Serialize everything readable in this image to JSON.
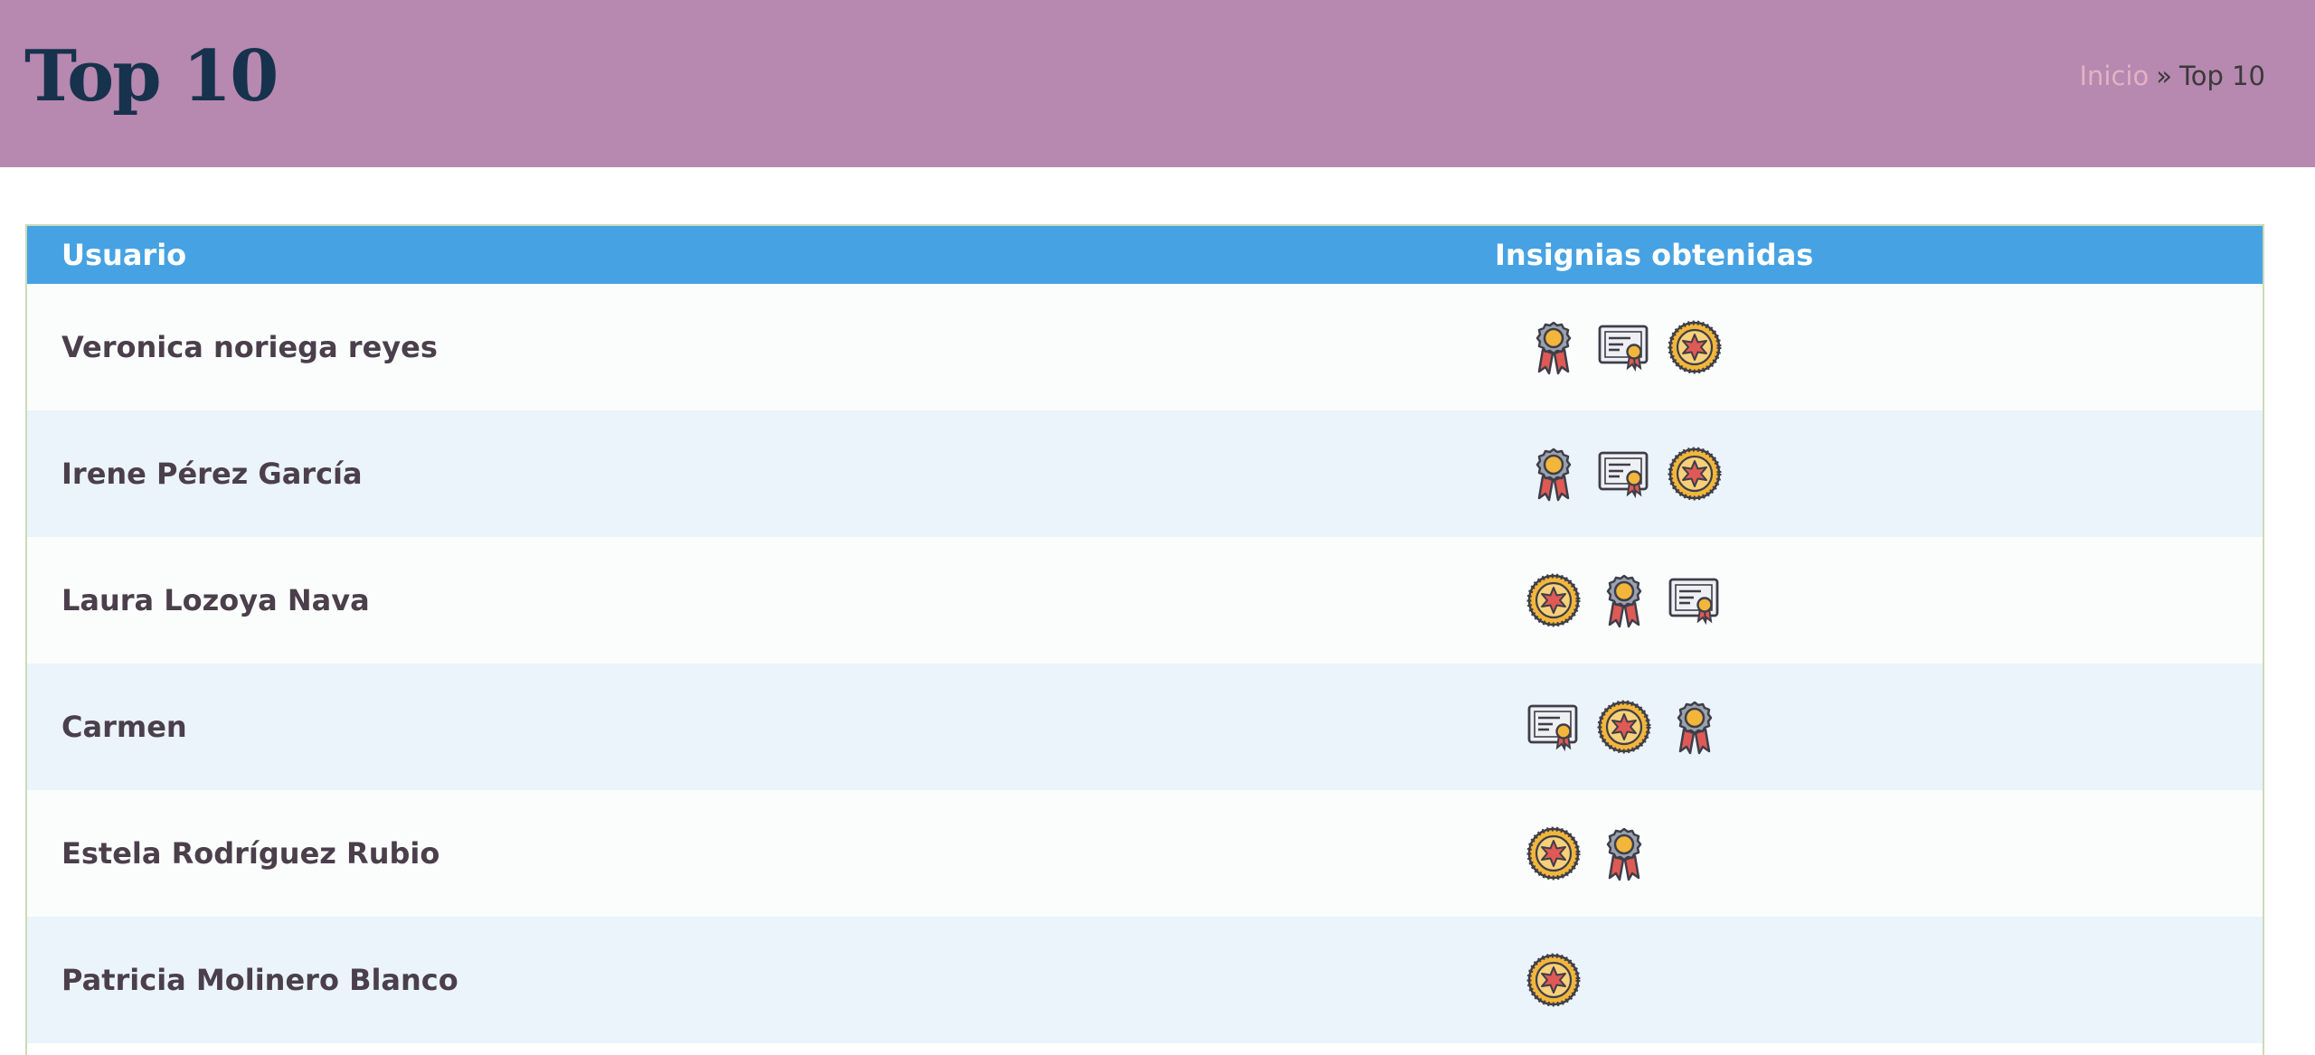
{
  "header": {
    "title": "Top 10",
    "breadcrumb": {
      "home": "Inicio",
      "separator": "»",
      "current": "Top 10"
    }
  },
  "table": {
    "columns": {
      "user": "Usuario",
      "badges": "Insignias obtenidas"
    },
    "rows": [
      {
        "name": "Veronica noriega reyes",
        "badges": [
          "medal-badge-icon",
          "certificate-badge-icon",
          "star-seal-badge-icon"
        ]
      },
      {
        "name": "Irene Pérez García",
        "badges": [
          "medal-badge-icon",
          "certificate-badge-icon",
          "star-seal-badge-icon"
        ]
      },
      {
        "name": "Laura Lozoya Nava",
        "badges": [
          "star-seal-badge-icon",
          "medal-badge-icon",
          "certificate-badge-icon"
        ]
      },
      {
        "name": "Carmen",
        "badges": [
          "certificate-badge-icon",
          "star-seal-badge-icon",
          "medal-badge-icon"
        ]
      },
      {
        "name": "Estela Rodríguez Rubio",
        "badges": [
          "star-seal-badge-icon",
          "medal-badge-icon"
        ]
      },
      {
        "name": "Patricia Molinero Blanco",
        "badges": [
          "star-seal-badge-icon"
        ]
      }
    ]
  },
  "colors": {
    "hero_bg": "#b788b0",
    "title": "#17324c",
    "table_header_bg": "#46a2e3",
    "row_alt_bg": "#ebf3fb",
    "breadcrumb_link": "#e3b2c4"
  }
}
